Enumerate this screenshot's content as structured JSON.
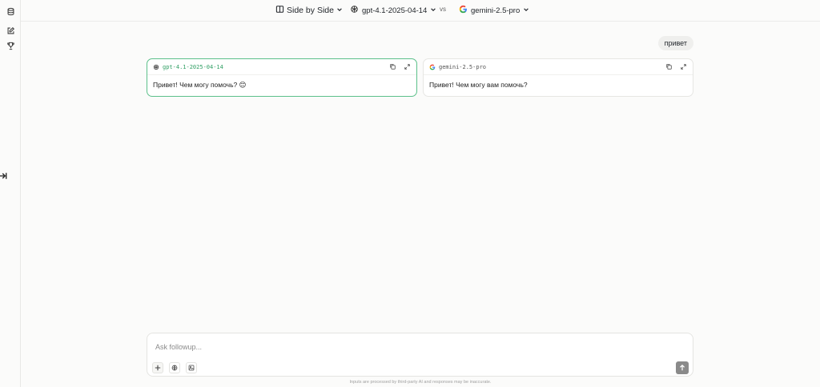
{
  "header": {
    "mode_label": "Side by Side",
    "model_a": "gpt-4.1-2025-04-14",
    "vs_label": "vs",
    "model_b": "gemini-2.5-pro"
  },
  "conversation": {
    "user_message": "привет",
    "responses": [
      {
        "model": "gpt-4.1-2025-04-14",
        "text": "Привет! Чем могу помочь? 😊",
        "selected": true
      },
      {
        "model": "gemini-2.5-pro",
        "text": "Привет! Чем могу вам помочь?",
        "selected": false
      }
    ]
  },
  "composer": {
    "placeholder": "Ask followup...",
    "value": ""
  },
  "footer": {
    "disclaimer": "Inputs are processed by third-party AI and responses may be inaccurate."
  },
  "colors": {
    "accent_green": "#5cc08a",
    "send_button": "#8a8a8a"
  },
  "icons": {
    "rail": [
      "database-icon",
      "edit-icon",
      "trophy-icon"
    ],
    "model_a": "openai-icon",
    "model_b": "google-icon",
    "card_actions": [
      "copy-icon",
      "expand-icon"
    ],
    "composer_tools": [
      "plus-icon",
      "globe-icon",
      "image-icon"
    ],
    "send": "arrow-up-icon"
  }
}
